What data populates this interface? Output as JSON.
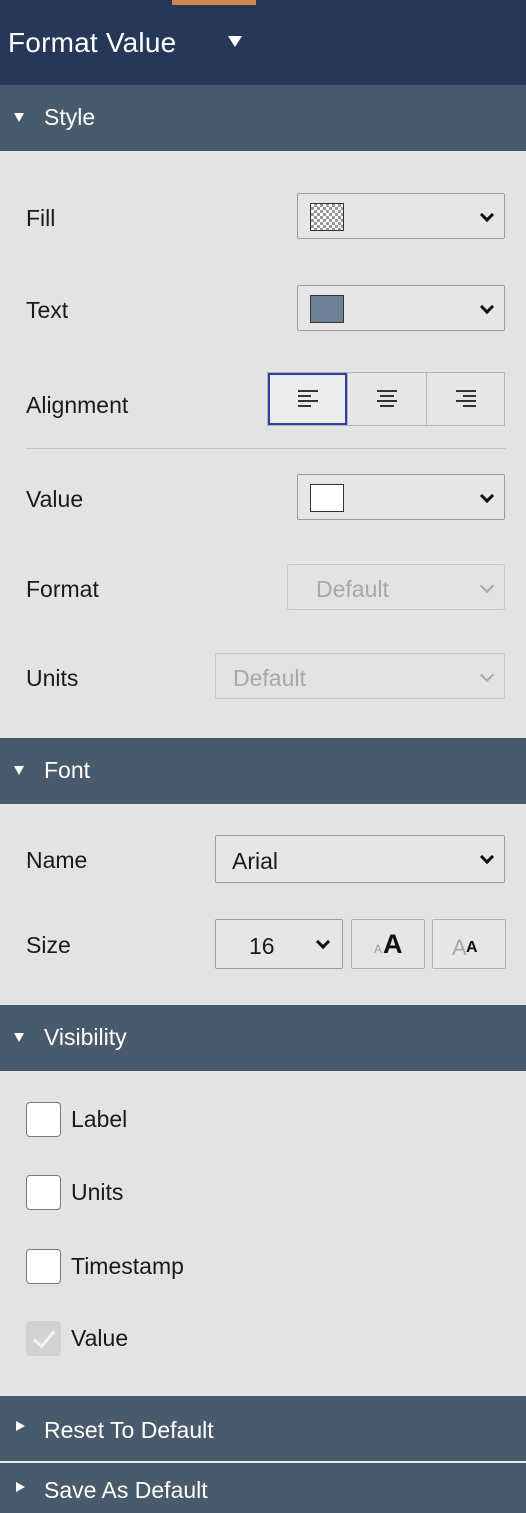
{
  "header": {
    "title": "Format Value",
    "accent_color": "#c88a52",
    "background_color": "#26375a"
  },
  "style_section": {
    "title": "Style",
    "fill": {
      "label": "Fill",
      "swatch": "transparent-checker"
    },
    "text": {
      "label": "Text",
      "swatch_color": "#6f8196"
    },
    "alignment": {
      "label": "Alignment",
      "options": [
        "left",
        "center",
        "right"
      ],
      "selected": "left"
    },
    "value": {
      "label": "Value",
      "swatch_color": "#ffffff"
    },
    "format": {
      "label": "Format",
      "selected": "Default",
      "disabled": true
    },
    "units": {
      "label": "Units",
      "selected": "Default",
      "disabled": true
    }
  },
  "font_section": {
    "title": "Font",
    "name": {
      "label": "Name",
      "selected": "Arial"
    },
    "size": {
      "label": "Size",
      "selected": "16",
      "increase_glyph": "A",
      "decrease_glyph": "A"
    }
  },
  "visibility_section": {
    "title": "Visibility",
    "items": [
      {
        "label": "Label",
        "checked": false,
        "disabled": false
      },
      {
        "label": "Units",
        "checked": false,
        "disabled": false
      },
      {
        "label": "Timestamp",
        "checked": false,
        "disabled": false
      },
      {
        "label": "Value",
        "checked": true,
        "disabled": true
      }
    ]
  },
  "reset_section": {
    "title": "Reset To Default",
    "collapsed": true
  },
  "save_section": {
    "title": "Save As Default",
    "collapsed": true
  },
  "colors": {
    "section_header": "#4a5a6d",
    "panel_bg": "#e3e3e3",
    "selected_border": "#2d3ea8"
  }
}
